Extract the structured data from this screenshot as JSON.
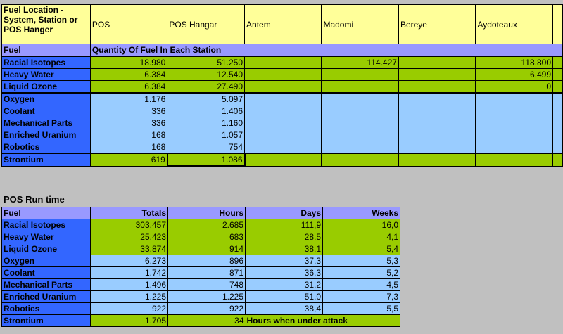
{
  "top_table": {
    "header": [
      "Fuel Location - System, Station or POS Hanger",
      "POS",
      "POS Hangar",
      "Antem",
      "Madomi",
      "Bereye",
      "Aydoteaux"
    ],
    "fuel_label": "Fuel",
    "section_label": "Quantity Of Fuel In Each Station",
    "rows": [
      {
        "name": "Racial Isotopes",
        "values": [
          "18.980",
          "51.250",
          "",
          "114.427",
          "",
          "118.800"
        ],
        "color": "green"
      },
      {
        "name": "Heavy Water",
        "values": [
          "6.384",
          "12.540",
          "",
          "",
          "",
          "6.499"
        ],
        "color": "green"
      },
      {
        "name": "Liquid Ozone",
        "values": [
          "6.384",
          "27.490",
          "",
          "",
          "",
          "0"
        ],
        "color": "green"
      },
      {
        "name": "Oxygen",
        "values": [
          "1.176",
          "5.097",
          "",
          "",
          "",
          ""
        ],
        "color": "lightblue"
      },
      {
        "name": "Coolant",
        "values": [
          "336",
          "1.406",
          "",
          "",
          "",
          ""
        ],
        "color": "lightblue"
      },
      {
        "name": "Mechanical Parts",
        "values": [
          "336",
          "1.160",
          "",
          "",
          "",
          ""
        ],
        "color": "lightblue"
      },
      {
        "name": "Enriched Uranium",
        "values": [
          "168",
          "1.057",
          "",
          "",
          "",
          ""
        ],
        "color": "lightblue"
      },
      {
        "name": "Robotics",
        "values": [
          "168",
          "754",
          "",
          "",
          "",
          ""
        ],
        "color": "lightblue"
      },
      {
        "name": "Strontium",
        "values": [
          "619",
          "1.086",
          "",
          "",
          "",
          ""
        ],
        "color": "green"
      }
    ]
  },
  "run_time": {
    "title": "POS Run time",
    "header": [
      "Fuel",
      "Totals",
      "Hours",
      "Days",
      "Weeks"
    ],
    "rows": [
      {
        "name": "Racial Isotopes",
        "values": [
          "303.457",
          "2.685",
          "111,9",
          "16,0"
        ],
        "color": "green"
      },
      {
        "name": "Heavy Water",
        "values": [
          "25.423",
          "683",
          "28,5",
          "4,1"
        ],
        "color": "green"
      },
      {
        "name": "Liquid Ozone",
        "values": [
          "33.874",
          "914",
          "38,1",
          "5,4"
        ],
        "color": "green"
      },
      {
        "name": "Oxygen",
        "values": [
          "6.273",
          "896",
          "37,3",
          "5,3"
        ],
        "color": "lightblue"
      },
      {
        "name": "Coolant",
        "values": [
          "1.742",
          "871",
          "36,3",
          "5,2"
        ],
        "color": "lightblue"
      },
      {
        "name": "Mechanical Parts",
        "values": [
          "1.496",
          "748",
          "31,2",
          "4,5"
        ],
        "color": "lightblue"
      },
      {
        "name": "Enriched Uranium",
        "values": [
          "1.225",
          "1.225",
          "51,0",
          "7,3"
        ],
        "color": "lightblue"
      },
      {
        "name": "Robotics",
        "values": [
          "922",
          "922",
          "38,4",
          "5,5"
        ],
        "color": "lightblue"
      }
    ],
    "strontium": {
      "name": "Strontium",
      "total": "1.705",
      "hours": "34",
      "note": "Hours when under attack"
    }
  }
}
